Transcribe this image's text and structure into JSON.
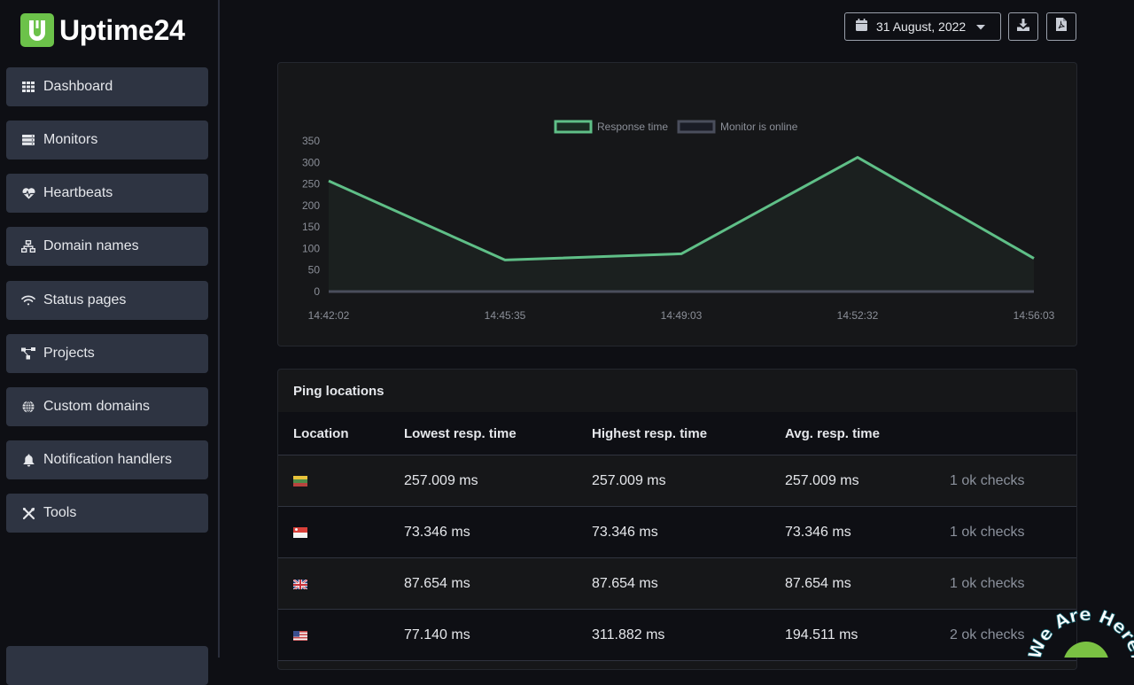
{
  "app": {
    "name": "Uptime24",
    "brand_color": "#6cc24a",
    "accent_line_color": "#5fbf87"
  },
  "sidebar": {
    "items": [
      {
        "label": "Dashboard",
        "icon": "grid-icon"
      },
      {
        "label": "Monitors",
        "icon": "server-icon"
      },
      {
        "label": "Heartbeats",
        "icon": "heart-pulse-icon"
      },
      {
        "label": "Domain names",
        "icon": "sitemap-icon"
      },
      {
        "label": "Status pages",
        "icon": "wifi-icon"
      },
      {
        "label": "Projects",
        "icon": "project-diagram-icon"
      },
      {
        "label": "Custom domains",
        "icon": "globe-icon"
      },
      {
        "label": "Notification handlers",
        "icon": "bell-icon"
      },
      {
        "label": "Tools",
        "icon": "tools-icon"
      }
    ]
  },
  "toolbar": {
    "date_label": "31 August, 2022",
    "date_icon": "calendar-icon",
    "download_icon": "download-icon",
    "pdf_icon": "file-pdf-icon"
  },
  "chart_data": {
    "type": "line",
    "title": "",
    "xlabel": "",
    "ylabel": "",
    "x": [
      "14:42:02",
      "14:45:35",
      "14:49:03",
      "14:52:32",
      "14:56:03"
    ],
    "series": [
      {
        "name": "Response time",
        "values": [
          257.009,
          73.346,
          87.654,
          311.882,
          77.14
        ],
        "color": "#5fbf87",
        "fill": true
      },
      {
        "name": "Monitor is online",
        "values": [
          0,
          0,
          0,
          0,
          0
        ],
        "color": "#4a4e5c"
      }
    ],
    "yticks": [
      0,
      50,
      100,
      150,
      200,
      250,
      300,
      350
    ],
    "ylim": [
      0,
      350
    ],
    "legend_position": "top-center",
    "grid": false
  },
  "ping_locations": {
    "title": "Ping locations",
    "columns": [
      "Location",
      "Lowest resp. time",
      "Highest resp. time",
      "Avg. resp. time",
      ""
    ],
    "rows": [
      {
        "flag": "lithuania-flag",
        "lowest": "257.009 ms",
        "highest": "257.009 ms",
        "avg": "257.009 ms",
        "checks": "1 ok checks"
      },
      {
        "flag": "singapore-flag",
        "lowest": "73.346 ms",
        "highest": "73.346 ms",
        "avg": "73.346 ms",
        "checks": "1 ok checks"
      },
      {
        "flag": "uk-flag",
        "lowest": "87.654 ms",
        "highest": "87.654 ms",
        "avg": "87.654 ms",
        "checks": "1 ok checks"
      },
      {
        "flag": "usa-flag",
        "lowest": "77.140 ms",
        "highest": "311.882 ms",
        "avg": "194.511 ms",
        "checks": "2 ok checks"
      }
    ]
  },
  "chat_widget": {
    "label": "We Are Here!"
  }
}
